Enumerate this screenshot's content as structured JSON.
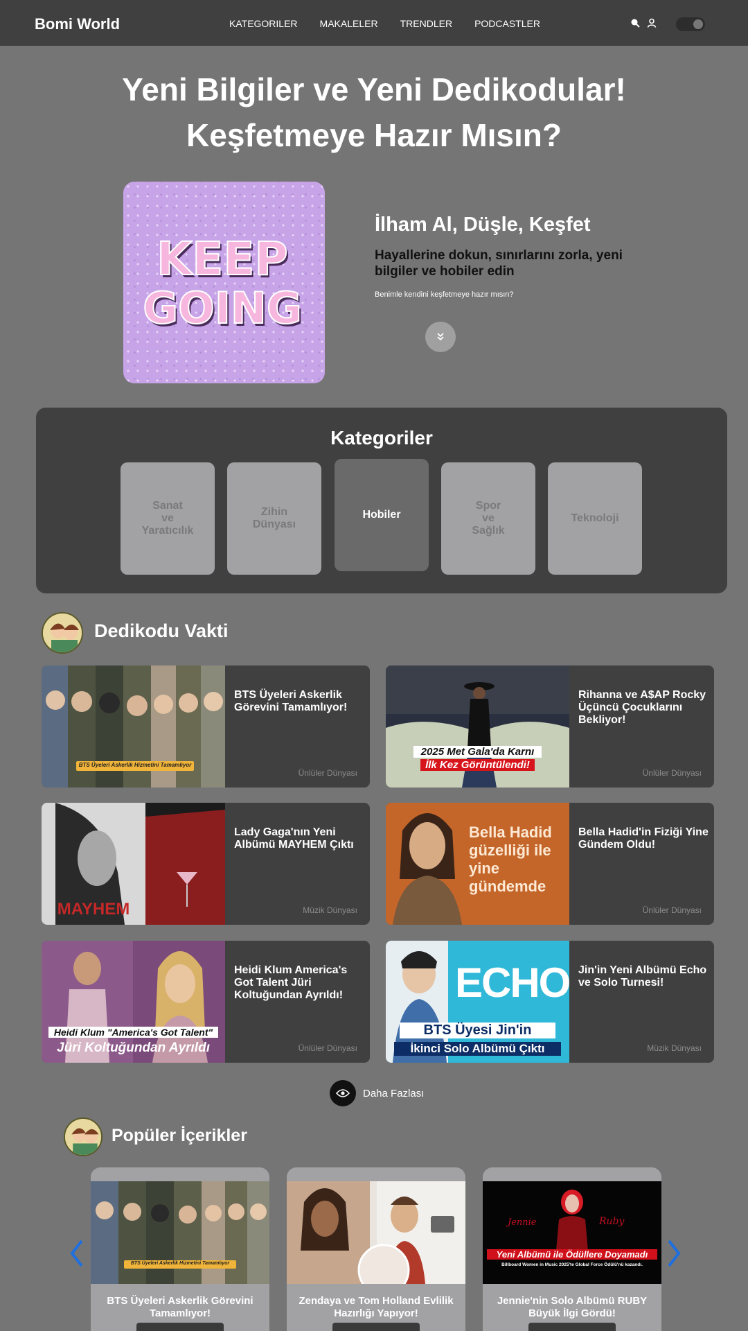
{
  "header": {
    "brand": "Bomi World",
    "nav": [
      "KATEGORILER",
      "MAKALELER",
      "TRENDLER",
      "PODCASTLER"
    ]
  },
  "hero": {
    "title_line1": "Yeni Bilgiler ve Yeni Dedikodular!",
    "title_line2": "Keşfetmeye Hazır Mısın?",
    "image_text_1": "KEEP",
    "image_text_2": "GOING",
    "heading": "İlham Al, Düşle, Keşfet",
    "subheading": "Hayallerine dokun, sınırlarını zorla, yeni bilgiler ve hobiler edin",
    "small": "Benimle kendini keşfetmeye hazır mısın?"
  },
  "categories": {
    "title": "Kategoriler",
    "items": [
      {
        "label": "Sanat\nve\nYaratıcılık"
      },
      {
        "label": "Zihin\nDünyası"
      },
      {
        "label": "Hobiler",
        "active": true
      },
      {
        "label": "Spor\nve\nSağlık"
      },
      {
        "label": "Teknoloji"
      }
    ]
  },
  "gossip": {
    "title": "Dedikodu Vakti",
    "cards": [
      {
        "title": "BTS Üyeleri Askerlik Görevini Tamamlıyor!",
        "category": "Ünlüler Dünyası",
        "caption": "BTS Üyeleri Askerlik Hizmetini Tamamlıyor"
      },
      {
        "title": "Rihanna ve A$AP Rocky Üçüncü Çocuklarını Bekliyor!",
        "category": "Ünlüler Dünyası",
        "caption1": "2025 Met Gala'da Karnı",
        "caption2": "İlk Kez Görüntülendi!"
      },
      {
        "title": "Lady Gaga'nın Yeni Albümü MAYHEM Çıktı",
        "category": "Müzik Dünyası",
        "caption": "MAYHEM"
      },
      {
        "title": "Bella Hadid'in Fiziği Yine Gündem Oldu!",
        "category": "Ünlüler Dünyası",
        "caption": "Bella Hadid güzelliği ile yine gündemde"
      },
      {
        "title": "Heidi Klum America's Got Talent Jüri Koltuğundan Ayrıldı!",
        "category": "Ünlüler Dünyası",
        "caption1": "Heidi Klum \"America's Got Talent\"",
        "caption2": "Jüri Koltuğundan Ayrıldı"
      },
      {
        "title": "Jin'in Yeni Albümü Echo ve Solo Turnesi!",
        "category": "Müzik Dünyası",
        "caption1": "BTS Üyesi Jin'in",
        "caption2": "İkinci Solo Albümü Çıktı",
        "logo": "ECHO"
      }
    ],
    "more_label": "Daha Fazlası"
  },
  "popular": {
    "title": "Popüler İçerikler",
    "cards": [
      {
        "title": "BTS Üyeleri Askerlik Görevini Tamamlıyor!",
        "caption": "BTS Üyeleri Askerlik Hizmetini Tamamlıyor"
      },
      {
        "title": "Zendaya ve Tom Holland Evlilik Hazırlığı Yapıyor!"
      },
      {
        "title": "Jennie'nin Solo Albümü RUBY Büyük İlgi Gördü!",
        "caption1": "Yeni Albümü ile Ödüllere Doyamadı",
        "caption2": "Billboard Women in Music 2025'te Global Force Ödülü'nü kazandı.",
        "script1": "Jennie",
        "script2": "Ruby"
      }
    ]
  },
  "colors": {
    "background": "#757575",
    "panel": "#404040",
    "card": "#a2a2a5",
    "arrow": "#1e6fe0"
  }
}
